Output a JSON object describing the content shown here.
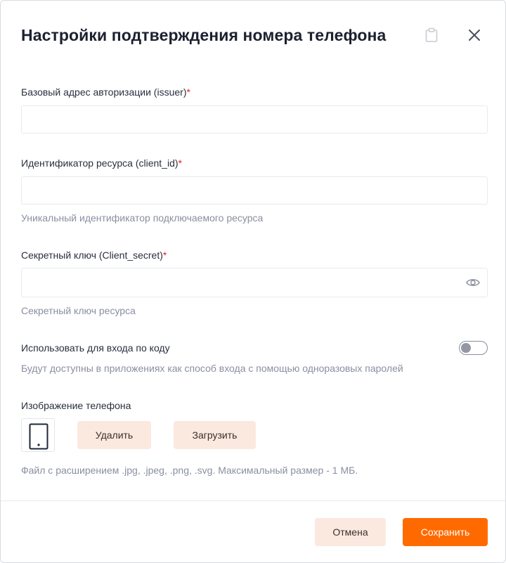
{
  "dialog": {
    "title": "Настройки подтверждения номера телефона",
    "icons": {
      "clipboard": "clipboard-icon",
      "close": "close-icon"
    }
  },
  "fields": {
    "issuer": {
      "label": "Базовый адрес авторизации (issuer)",
      "required_mark": "*",
      "value": "",
      "placeholder": ""
    },
    "client_id": {
      "label": "Идентификатор ресурса (client_id)",
      "required_mark": "*",
      "value": "",
      "placeholder": "",
      "hint": "Уникальный идентификатор подключаемого ресурса"
    },
    "client_secret": {
      "label": "Секретный ключ (Client_secret)",
      "required_mark": "*",
      "value": "",
      "placeholder": "",
      "hint": "Секретный ключ ресурса",
      "icon": "eye-icon"
    }
  },
  "code_login": {
    "label": "Использовать для входа по коду",
    "hint": "Будут доступны в приложениях как способ входа с помощью одноразовых паролей",
    "enabled": false
  },
  "phone_image": {
    "label": "Изображение телефона",
    "icon": "phone-icon",
    "delete_label": "Удалить",
    "upload_label": "Загрузить",
    "hint": "Файл с расширением .jpg, .jpeg, .png, .svg. Максимальный размер - 1 МБ."
  },
  "footer": {
    "cancel_label": "Отмена",
    "save_label": "Сохранить"
  },
  "colors": {
    "primary": "#ff6a00",
    "soft_button": "#fbe9df",
    "required": "#e02424",
    "hint": "#8a8fa0"
  }
}
